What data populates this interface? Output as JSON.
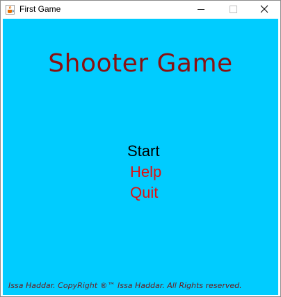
{
  "window": {
    "title": "First Game",
    "app_icon": "java-cup-icon",
    "controls": {
      "minimize_icon": "minimize-icon",
      "maximize_icon": "maximize-icon",
      "close_icon": "close-icon"
    }
  },
  "game": {
    "background_color": "#00ccff",
    "title": "Shooter Game",
    "title_color": "#8a1111",
    "menu": [
      {
        "label": "Start",
        "color": "#000000",
        "selected": true
      },
      {
        "label": "Help",
        "color": "#e01010",
        "selected": false
      },
      {
        "label": "Quit",
        "color": "#e01010",
        "selected": false
      }
    ],
    "footer": "Issa Haddar. CopyRight ®™ Issa Haddar. All Rights reserved."
  }
}
